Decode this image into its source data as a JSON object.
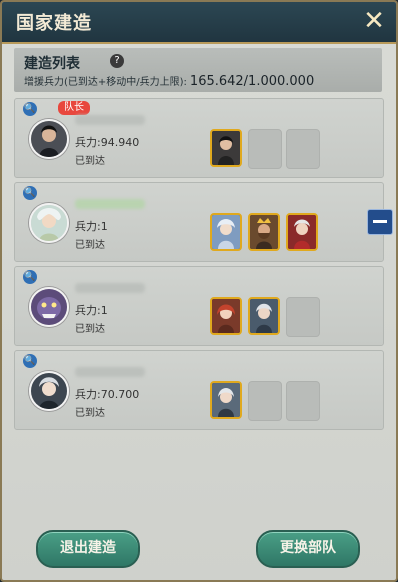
{
  "window": {
    "title": "国家建造",
    "close_label": "✕"
  },
  "summary": {
    "title": "建造列表",
    "help_label": "?",
    "line_label": "增援兵力(已到达+移动中/兵力上限):",
    "line_value": "165.642/1.000.000"
  },
  "members": [
    {
      "leader_label": "队长",
      "troops_label": "兵力:94.940",
      "status": "已到达",
      "hero_count": 1,
      "empty_slots": 2,
      "name_blurred": true
    },
    {
      "troops_label": "兵力:1",
      "status": "已到达",
      "hero_count": 3,
      "empty_slots": 0,
      "name_blurred": true,
      "has_remove_button": true
    },
    {
      "troops_label": "兵力:1",
      "status": "已到达",
      "hero_count": 2,
      "empty_slots": 1,
      "name_blurred": true
    },
    {
      "troops_label": "兵力:70.700",
      "status": "已到达",
      "hero_count": 1,
      "empty_slots": 2,
      "name_blurred": true
    }
  ],
  "buttons": {
    "exit": "退出建造",
    "swap": "更换部队"
  },
  "icons": {
    "search": "magnifier-icon",
    "help": "question-icon",
    "remove": "minus-icon",
    "close": "close-icon"
  },
  "colors": {
    "header": "#2c4753",
    "accent_gold": "#e0a91e",
    "button_green": "#3a8a74",
    "leader_badge": "#e8473d"
  }
}
